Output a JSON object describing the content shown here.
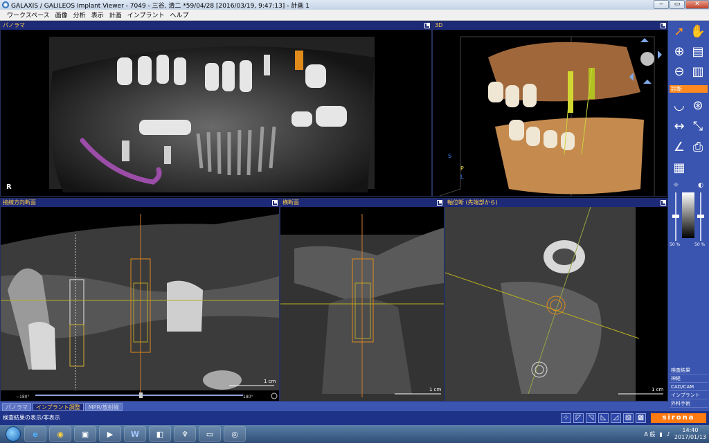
{
  "window": {
    "title": "GALAXIS / GALILEOS Implant Viewer - 7049 - 三谷, 清二 *59/04/28 [2016/03/19, 9:47:13] - 計画 1",
    "min": "‒",
    "max": "▭",
    "close": "✕"
  },
  "menu": [
    "ワークスペース",
    "画像",
    "分析",
    "表示",
    "計画",
    "インプラント",
    "ヘルプ"
  ],
  "panels": {
    "panorama": {
      "title": "パノラマ",
      "marker": "R"
    },
    "view3d": {
      "title": "3D",
      "axis_s": "S",
      "axis_p": "P",
      "axis_l": "L"
    },
    "tangential": {
      "title": "接線方向断面",
      "scale": "1 cm",
      "angle_left": "−180°",
      "angle_right": "180°"
    },
    "cross": {
      "title": "横断面",
      "scale": "1 cm"
    },
    "axial": {
      "title": "軸位断 (先端部から)",
      "scale": "1 cm"
    }
  },
  "sidebar": {
    "section": "診断",
    "contrast_left": "50 %",
    "contrast_right": "50 %",
    "menu": [
      "検査結果",
      "神経",
      "CAD/CAM",
      "インプラント",
      "外科手術"
    ]
  },
  "tabs": [
    {
      "label": "パノラマ",
      "active": false
    },
    {
      "label": "インプラント調整",
      "active": true
    },
    {
      "label": "MPR/放射線",
      "active": false
    }
  ],
  "status": {
    "text": "検査結果の表示/非表示",
    "brand": "sirona"
  },
  "taskbar": {
    "ie": "e",
    "chrome": "◉",
    "word": "W",
    "time": "14:40",
    "date": "2017/01/13",
    "ime": "A 般"
  }
}
